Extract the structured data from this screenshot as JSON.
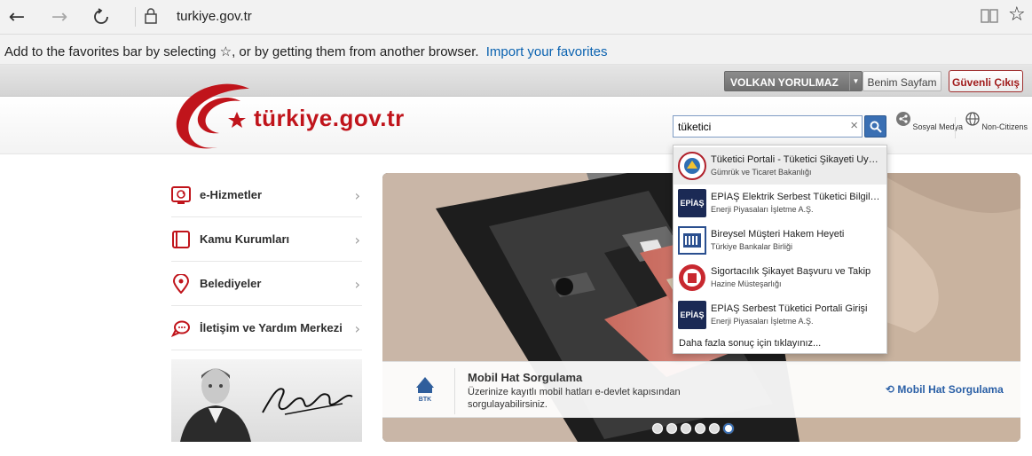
{
  "browser": {
    "url": "turkiye.gov.tr",
    "favorites_text": "Add to the favorites bar by selecting ☆, or by getting them from another browser.",
    "favorites_link": "Import your favorites"
  },
  "userbar": {
    "username": "VOLKAN YORULMAZ",
    "my_page": "Benim Sayfam",
    "logout": "Güvenli Çıkış"
  },
  "header": {
    "logo_text": "türkiye.gov.tr",
    "search_value": "tüketici",
    "tools": [
      {
        "label": "Sosyal Medya",
        "icon": "share-icon"
      },
      {
        "label": "Non-Citizens",
        "icon": "globe-icon"
      }
    ]
  },
  "menu": [
    {
      "label": "e-Hizmetler",
      "icon": "services-icon"
    },
    {
      "label": "Kamu Kurumları",
      "icon": "institutions-icon"
    },
    {
      "label": "Belediyeler",
      "icon": "location-pin-icon"
    },
    {
      "label": "İletişim ve Yardım Merkezi",
      "icon": "help-chat-icon"
    }
  ],
  "slide": {
    "title": "Mobil Hat Sorgulama",
    "desc": "Üzerinize kayıtlı mobil hatları e-devlet kapısından sorgulayabilirsiniz.",
    "link": "Mobil Hat Sorgulama",
    "logo_caption": "BTK",
    "active_dot": 5,
    "dot_count": 6
  },
  "suggestions": [
    {
      "title": "Tüketici Portali - Tüketici Şikayeti Uyg...",
      "sub": "Gümrük ve Ticaret Bakanlığı",
      "icon": "customs-ministry-logo"
    },
    {
      "title": "EPİAŞ Elektrik Serbest Tüketici Bilgiler...",
      "sub": "Enerji Piyasaları İşletme A.Ş.",
      "icon": "epias-logo"
    },
    {
      "title": "Bireysel Müşteri Hakem Heyeti",
      "sub": "Türkiye Bankalar Birliği",
      "icon": "banks-association-logo"
    },
    {
      "title": "Sigortacılık Şikayet Başvuru ve Takip",
      "sub": "Hazine Müsteşarlığı",
      "icon": "treasury-logo"
    },
    {
      "title": "EPİAŞ Serbest Tüketici Portali Girişi",
      "sub": "Enerji Piyasaları İşletme A.Ş.",
      "icon": "epias-logo"
    }
  ],
  "suggestions_more": "Daha fazla sonuç için tıklayınız...",
  "colors": {
    "brand_red": "#c0141b",
    "link_blue": "#2a5fa6",
    "search_blue": "#3a6fb3"
  }
}
